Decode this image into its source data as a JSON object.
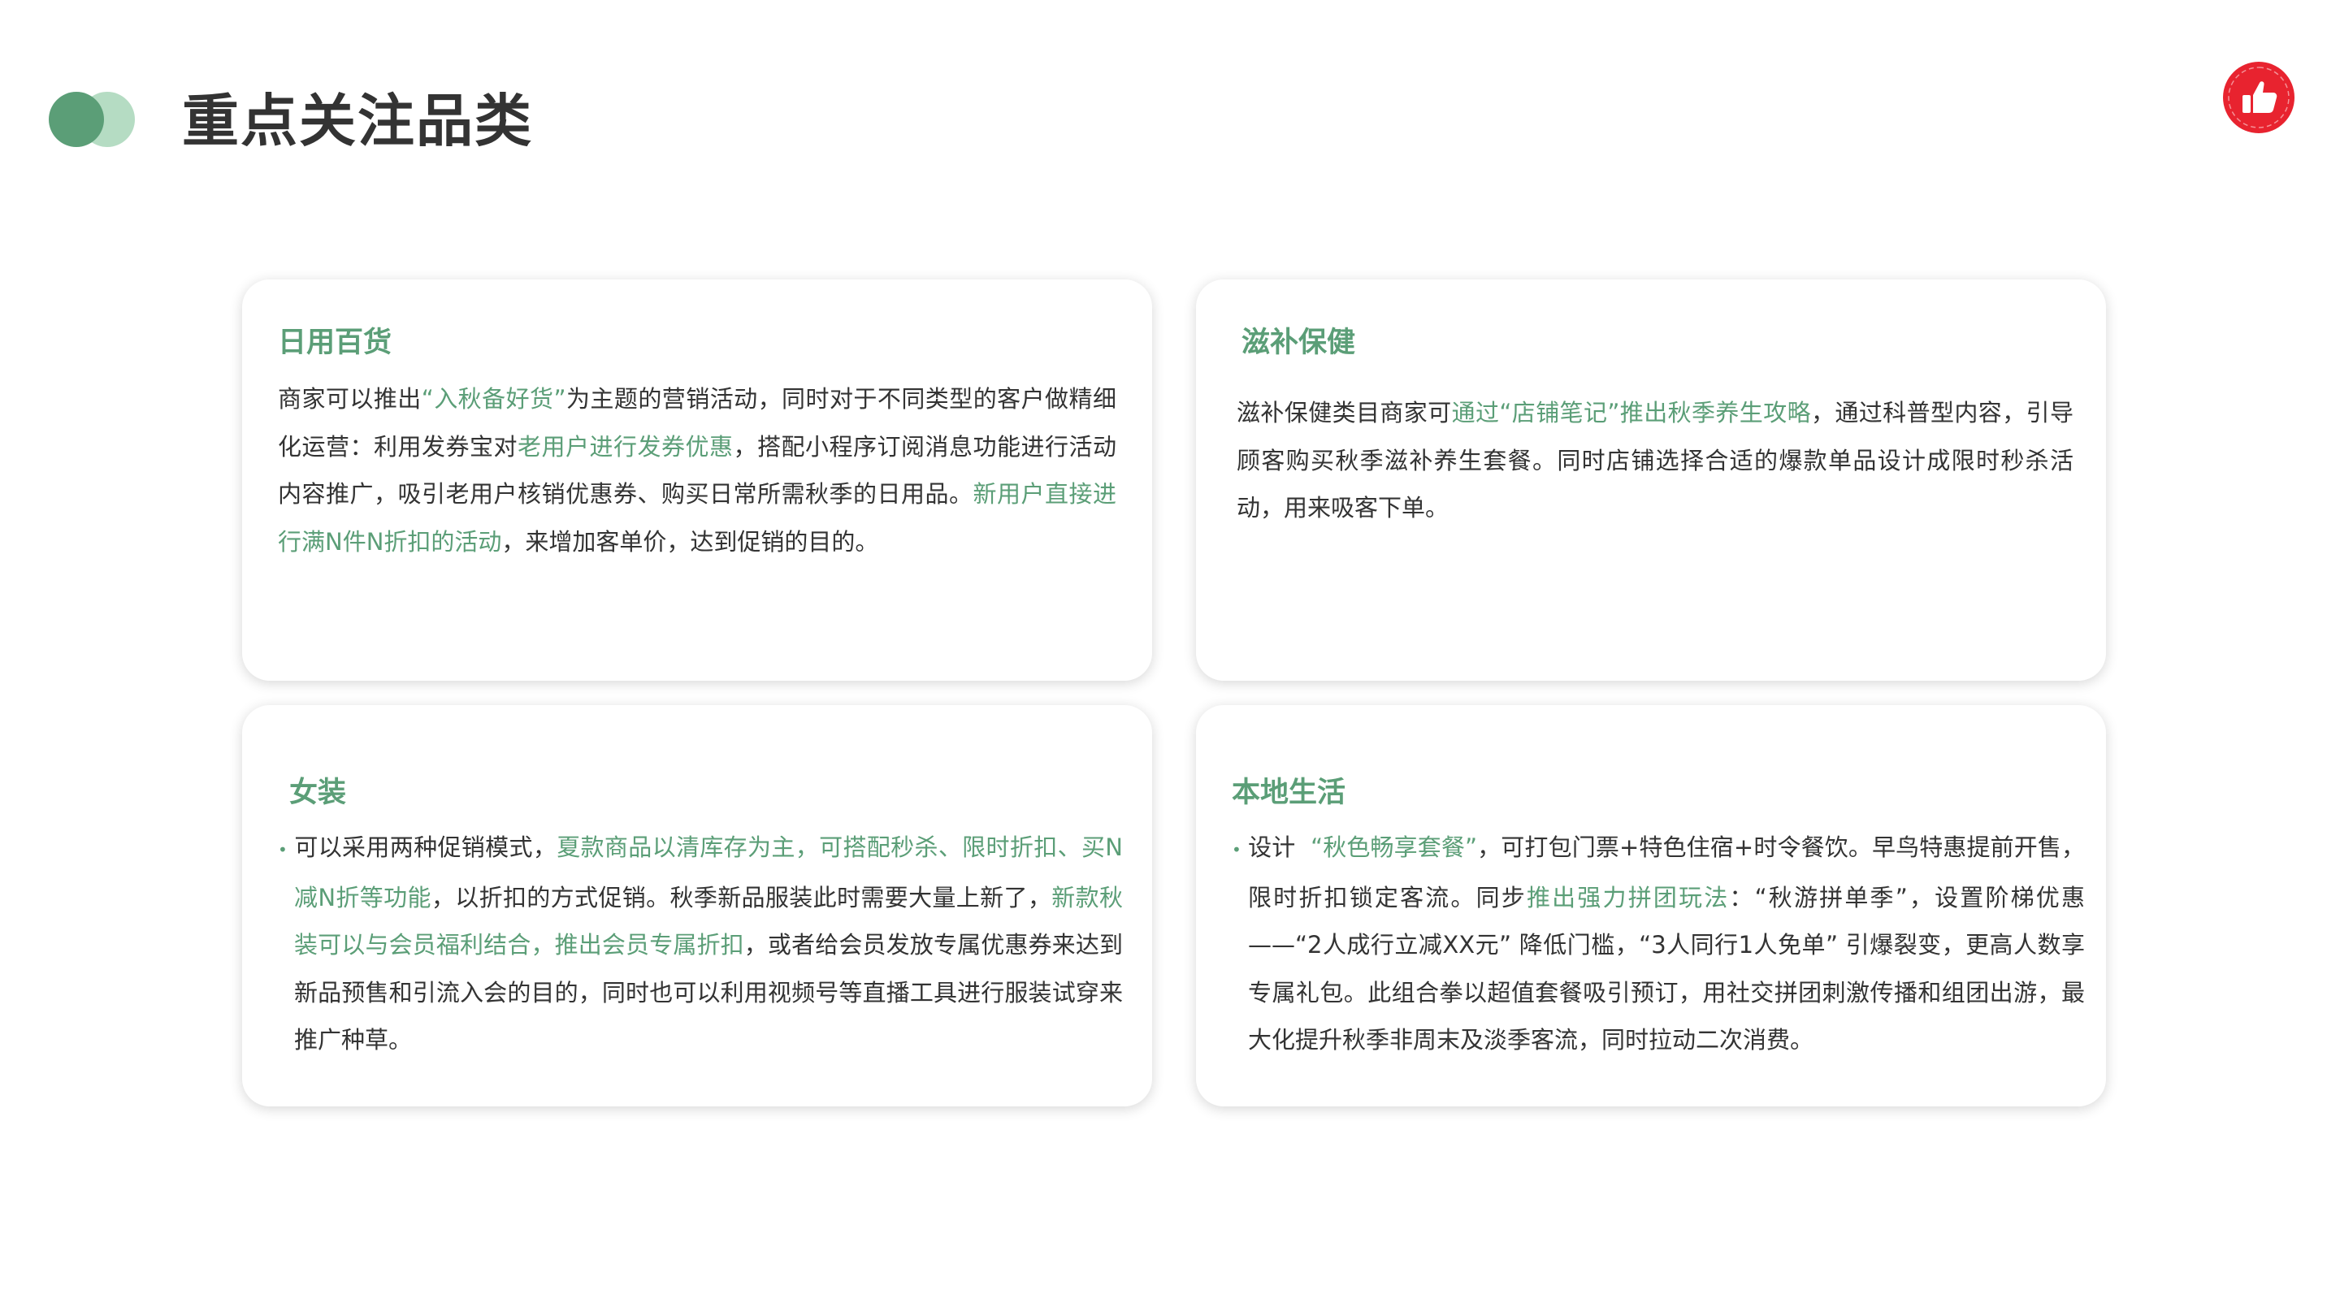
{
  "page": {
    "title": "重点关注品类"
  },
  "brand": {
    "accent_color": "#5b9e77",
    "accent_light_color": "#b5dcc3",
    "badge_color": "#e8232f",
    "badge_icon": "thumbs-up-icon"
  },
  "cards": {
    "daily": {
      "title": "日用百货",
      "seg1": "商家可以推出",
      "seg2": "“入秋备好货”",
      "seg3": "为主题的营销活动，同时对于不同类型的客户做精细化运营：利用发券宝对",
      "seg4": "老用户进行发券优惠",
      "seg5": "，搭配小程序订阅消息功能进行活动内容推广，吸引老用户核销优惠券、购买日常所需秋季的日用品。",
      "seg6": "新用户直接进行满N件N折扣的活动",
      "seg7": "，来增加客单价，达到促销的目的。"
    },
    "tonic": {
      "title": "滋补保健",
      "seg1": "滋补保健类目商家可",
      "seg2": "通过“店铺笔记”推出秋季养生攻略",
      "seg3": "，通过科普型内容，引导顾客购买秋季滋补养生套餐。同时店铺选择合适的爆款单品设计成限时秒杀活动，用来吸客下单。"
    },
    "women": {
      "title": "女装",
      "bullet": "•",
      "seg1": "可以采用两种促销模式，",
      "seg2": "夏款商品以清库存为主，可搭配秒杀、限时折扣、买N减N折等功能",
      "seg3": "，以折扣的方式促销。秋季新品服装此时需要大量上新了，",
      "seg4": "新款秋装可以与会员福利结合，推出会员专属折扣",
      "seg5": "，或者给会员发放专属优惠券来达到新品预售和引流入会的目的，同时也可以利用视频号等直播工具进行服装试穿来推广种草。"
    },
    "local": {
      "title": "本地生活",
      "bullet": "•",
      "seg1": "设计  ",
      "seg2": "“秋色畅享套餐”",
      "seg3": "，可打包门票+特色住宿+时令餐饮。早鸟特惠提前开售，限时折扣锁定客流。同步",
      "seg4": "推出强力拼团玩法",
      "seg5": "：“秋游拼单季”，设置阶梯优惠——“2人成行立减XX元” 降低门槛，“3人同行1人免单” 引爆裂变，更高人数享专属礼包。此组合拳以超值套餐吸引预订，用社交拼团刺激传播和组团出游，最大化提升秋季非周末及淡季客流，同时拉动二次消费。"
    }
  }
}
